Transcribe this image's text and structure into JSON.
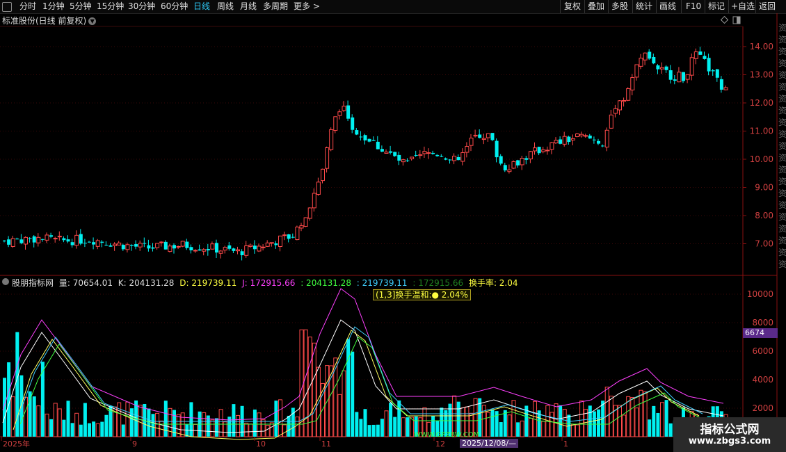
{
  "toolbar": {
    "periods": [
      "分时",
      "1分钟",
      "5分钟",
      "15分钟",
      "30分钟",
      "60分钟",
      "日线",
      "周线",
      "月线",
      "多周期",
      "更多 >"
    ],
    "active_period": "日线",
    "right_buttons": [
      "复权",
      "叠加",
      "多股",
      "统计",
      "画线",
      "F10",
      "标记",
      "+自选",
      "返回"
    ]
  },
  "chart_title": "标准股份(日线 前复权)",
  "price_axis": {
    "ticks": [
      "14.00",
      "13.00",
      "12.00",
      "11.00",
      "10.00",
      "9.00",
      "8.00",
      "7.00"
    ]
  },
  "indicator": {
    "name": "股朋指标网",
    "vol_label": "量: 70654.01",
    "k_label": "K: 204131.28",
    "d_label": "D: 219739.11",
    "j_label": "J: 172915.66",
    "v1": ": 204131.28",
    "v2": ": 219739.11",
    "v3": ": 172915.66",
    "turnover_label": "换手率: 2.04",
    "tag": "(1,3]换手温和:● 2.04%",
    "axis_ticks": [
      "10000",
      "8000",
      "6000",
      "4000",
      "2000"
    ],
    "current_value_label": "6674"
  },
  "date_axis": {
    "labels": [
      "2025年",
      "9",
      "10",
      "11",
      "12",
      "1"
    ],
    "cursor_date": "2025/12/08/—",
    "site_text": "WWW.GPZBW.COM"
  },
  "right_side_fragments": [
    "资",
    "资",
    "资",
    "资",
    "资",
    "资",
    "资",
    "资",
    "资",
    "资",
    "资",
    "资",
    "资",
    "资",
    "资",
    "资",
    "资",
    "资",
    "资",
    "资",
    "资"
  ],
  "watermark": {
    "line1": "指标公式网",
    "line2": "www.zbgs3.com"
  },
  "colors": {
    "up": "#ff4040",
    "down": "#00ffff",
    "k": "#ffffff",
    "d": "#ffff60",
    "j": "#ff40ff",
    "grid": "#501010"
  }
}
